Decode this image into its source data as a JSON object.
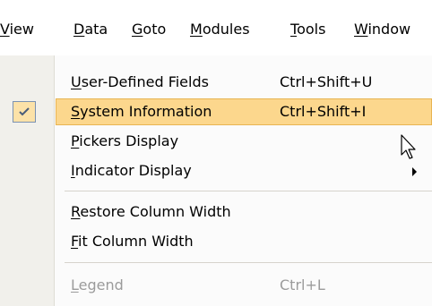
{
  "menubar": {
    "view": "View",
    "data": "Data",
    "goto": "Goto",
    "modules": "Modules",
    "tools": "Tools",
    "window": "Window"
  },
  "dropdown": {
    "user_defined_fields": {
      "label": "User-Defined Fields",
      "shortcut": "Ctrl+Shift+U"
    },
    "system_information": {
      "label": "System Information",
      "shortcut": "Ctrl+Shift+I",
      "checked": true,
      "highlighted": true
    },
    "pickers_display": {
      "label": "Pickers Display"
    },
    "indicator_display": {
      "label": "Indicator Display",
      "has_submenu": true
    },
    "restore_column_width": {
      "label": "Restore Column Width"
    },
    "fit_column_width": {
      "label": "Fit Column Width"
    },
    "legend": {
      "label": "Legend",
      "shortcut": "Ctrl+L",
      "disabled": true
    }
  },
  "colors": {
    "highlight_fill": "#fcd78d",
    "highlight_border": "#e8b452",
    "gutter": "#f1f0eb",
    "disabled_text": "#9b9b9b"
  },
  "icons": {
    "check": "check-icon",
    "submenu": "submenu-arrow-icon",
    "cursor": "mouse-cursor-icon"
  }
}
